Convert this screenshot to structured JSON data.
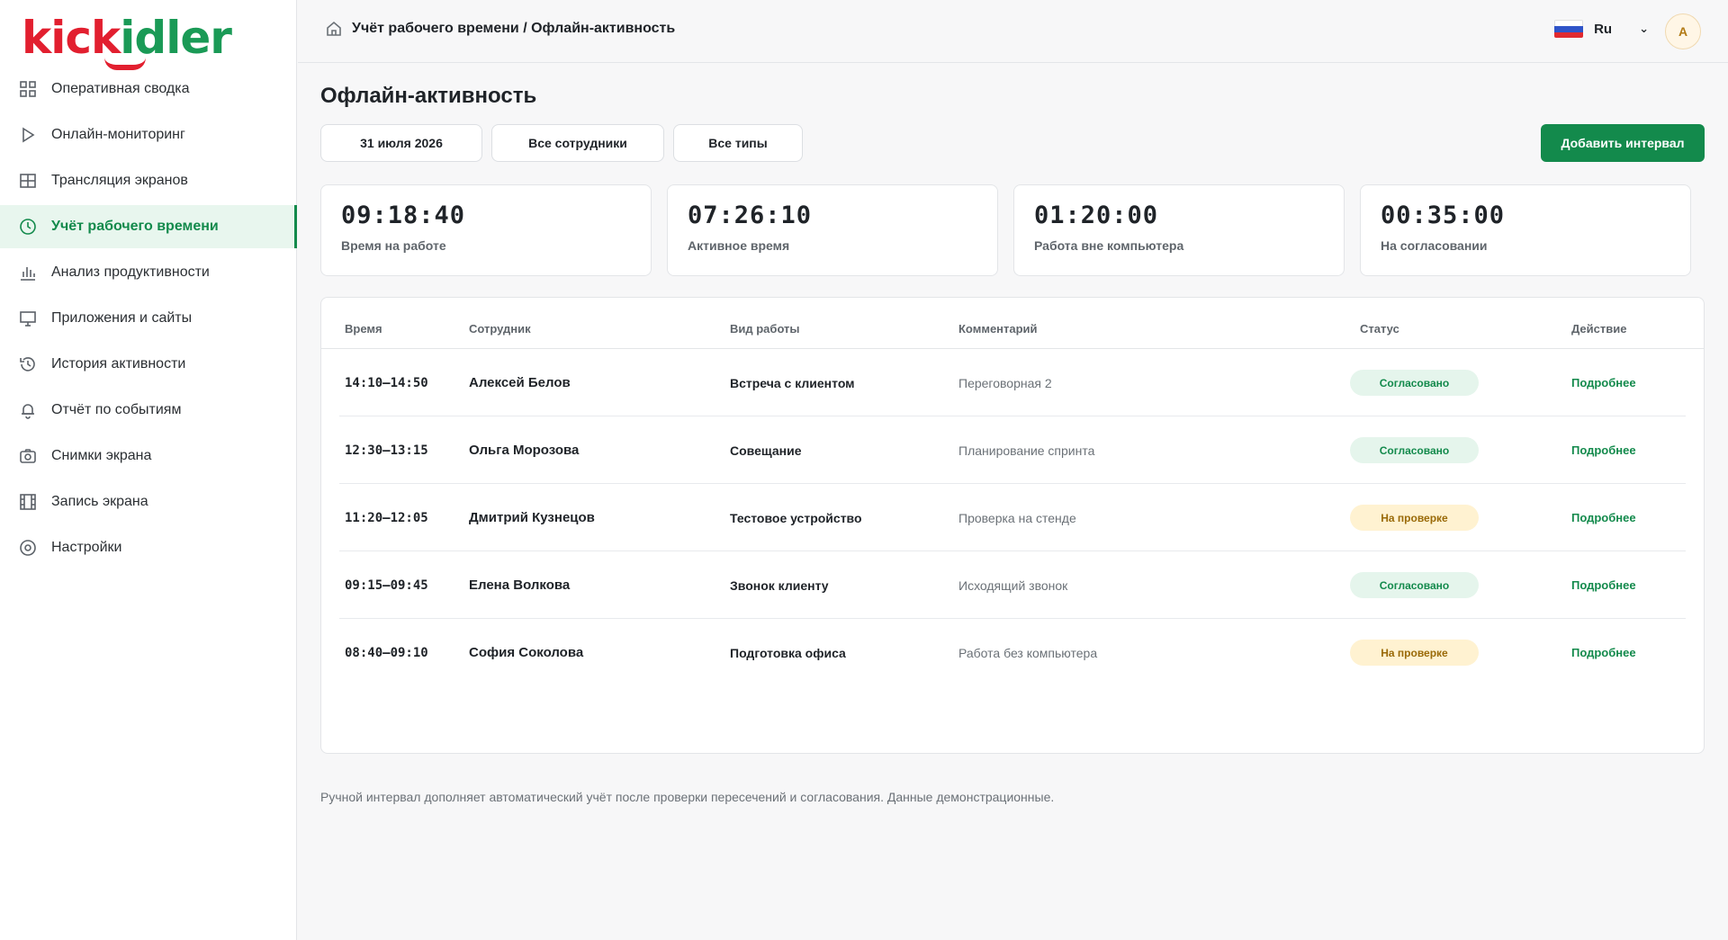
{
  "logo": {
    "part1": "kick",
    "part2": "idler"
  },
  "sidebar": {
    "items": [
      {
        "label": "Оперативная сводка",
        "icon": "grid-icon",
        "active": false
      },
      {
        "label": "Онлайн-мониторинг",
        "icon": "play-icon",
        "active": false
      },
      {
        "label": "Трансляция экранов",
        "icon": "table-icon",
        "active": false
      },
      {
        "label": "Учёт рабочего времени",
        "icon": "clock-icon",
        "active": true
      },
      {
        "label": "Анализ продуктивности",
        "icon": "bar-chart-icon",
        "active": false
      },
      {
        "label": "Приложения и сайты",
        "icon": "monitor-icon",
        "active": false
      },
      {
        "label": "История активности",
        "icon": "history-icon",
        "active": false
      },
      {
        "label": "Отчёт по событиям",
        "icon": "bell-icon",
        "active": false
      },
      {
        "label": "Снимки экрана",
        "icon": "camera-icon",
        "active": false
      },
      {
        "label": "Запись экрана",
        "icon": "film-icon",
        "active": false
      },
      {
        "label": "Настройки",
        "icon": "settings-icon",
        "active": false
      }
    ]
  },
  "header": {
    "breadcrumb": "Учёт рабочего времени / Офлайн-активность",
    "language": "Ru",
    "avatar": "A"
  },
  "page": {
    "title": "Офлайн-активность",
    "filters": {
      "date": "31 июля 2026",
      "employees": "Все сотрудники",
      "types": "Все типы"
    },
    "add_button": "Добавить интервал"
  },
  "stats": [
    {
      "value": "09:18:40",
      "label": "Время на работе"
    },
    {
      "value": "07:26:10",
      "label": "Активное время"
    },
    {
      "value": "01:20:00",
      "label": "Работа вне компьютера"
    },
    {
      "value": "00:35:00",
      "label": "На согласовании"
    }
  ],
  "table": {
    "headers": {
      "time": "Время",
      "employee": "Сотрудник",
      "type": "Вид работы",
      "comment": "Комментарий",
      "status": "Статус",
      "action": "Действие"
    },
    "rows": [
      {
        "time": "14:10–14:50",
        "employee": "Алексей Белов",
        "type": "Встреча с клиентом",
        "comment": "Переговорная 2",
        "status": "Согласовано",
        "status_kind": "ok",
        "action": "Подробнее"
      },
      {
        "time": "12:30–13:15",
        "employee": "Ольга Морозова",
        "type": "Совещание",
        "comment": "Планирование спринта",
        "status": "Согласовано",
        "status_kind": "ok",
        "action": "Подробнее"
      },
      {
        "time": "11:20–12:05",
        "employee": "Дмитрий Кузнецов",
        "type": "Тестовое устройство",
        "comment": "Проверка на стенде",
        "status": "На проверке",
        "status_kind": "wait",
        "action": "Подробнее"
      },
      {
        "time": "09:15–09:45",
        "employee": "Елена Волкова",
        "type": "Звонок клиенту",
        "comment": "Исходящий звонок",
        "status": "Согласовано",
        "status_kind": "ok",
        "action": "Подробнее"
      },
      {
        "time": "08:40–09:10",
        "employee": "София Соколова",
        "type": "Подготовка офиса",
        "comment": "Работа без компьютера",
        "status": "На проверке",
        "status_kind": "wait",
        "action": "Подробнее"
      }
    ]
  },
  "footnote": "Ручной интервал дополняет автоматический учёт после проверки пересечений и согласования. Данные демонстрационные.",
  "colors": {
    "accent": "#138a4c",
    "logo_red": "#e21f2f",
    "pending_bg": "#fff2d1",
    "approved_bg": "#e5f5ec"
  }
}
